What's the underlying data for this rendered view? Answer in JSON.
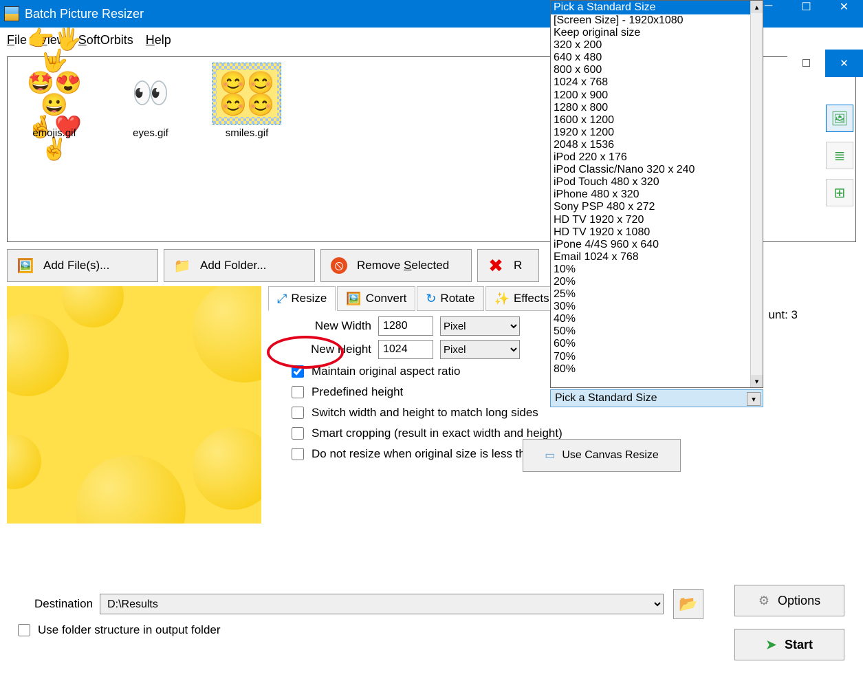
{
  "window": {
    "title": "Batch Picture Resizer"
  },
  "menu": {
    "file": "File",
    "view": "View",
    "softorbits": "SoftOrbits",
    "help": "Help",
    "file_u": "F",
    "view_u": "V",
    "softorbits_u": "S",
    "help_u": "H"
  },
  "thumbs": [
    {
      "name": "emojis.gif"
    },
    {
      "name": "eyes.gif"
    },
    {
      "name": "smiles.gif"
    }
  ],
  "buttons": {
    "addfile": "Add File(s)...",
    "addfolder": "Add Folder...",
    "remove": "Remove Selected",
    "removeall": "Remove All"
  },
  "tabs": {
    "resize": "Resize",
    "convert": "Convert",
    "rotate": "Rotate",
    "effects": "Effects"
  },
  "resize": {
    "newwidth_label": "New Width",
    "newheight_label": "New Height",
    "width_value": "1280",
    "height_value": "1024",
    "unit": "Pixel",
    "maintain": "Maintain original aspect ratio",
    "predefined": "Predefined height",
    "switch": "Switch width and height to match long sides",
    "smart": "Smart cropping (result in exact width and height)",
    "noresize": "Do not resize when original size is less then a new one",
    "canvasbtn": "Use Canvas Resize"
  },
  "stdsize": {
    "header": "Pick a Standard Size",
    "selected": "Pick a Standard Size",
    "items": [
      "[Screen Size] - 1920x1080",
      "Keep original size",
      "320 x 200",
      "640 x 480",
      "800 x 600",
      "1024 x 768",
      "1200 x 900",
      "1280 x 800",
      "1600 x 1200",
      "1920 x 1200",
      "2048 x 1536",
      "iPod 220 x 176",
      "iPod Classic/Nano 320 x 240",
      "iPod Touch 480 x 320",
      "iPhone 480 x 320",
      "Sony PSP 480 x 272",
      "HD TV 1920 x 720",
      "HD TV 1920 x 1080",
      "iPone 4/4S 960 x 640",
      "Email 1024 x 768",
      "10%",
      "20%",
      "25%",
      "30%",
      "40%",
      "50%",
      "60%",
      "70%",
      "80%"
    ]
  },
  "destination": {
    "label": "Destination",
    "value": "D:\\Results"
  },
  "options_label": "Options",
  "start_label": "Start",
  "usefolder_label": "Use folder structure in output folder",
  "count_label": "unt: 3"
}
